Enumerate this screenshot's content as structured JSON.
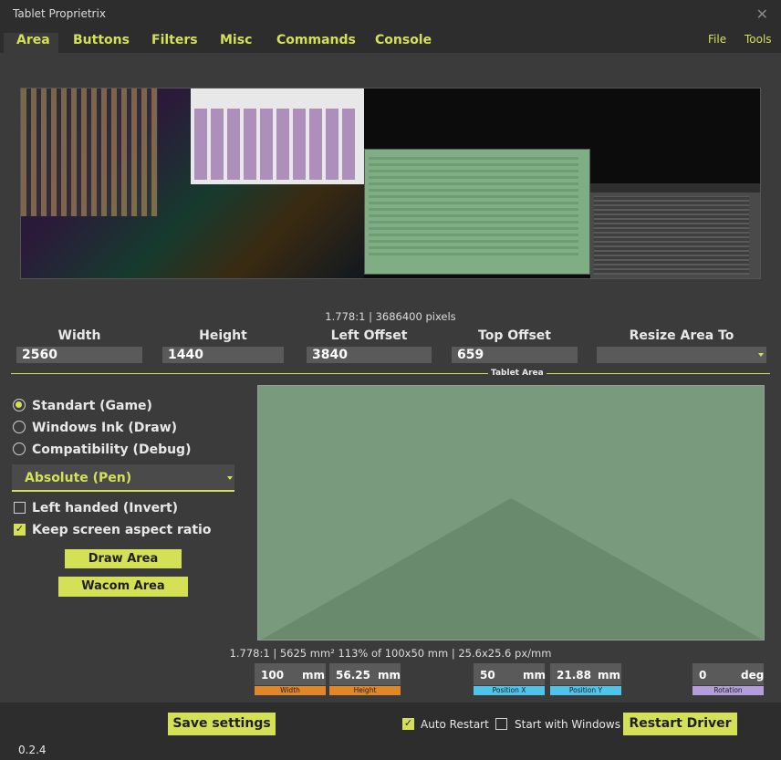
{
  "window": {
    "title": "Tablet Proprietrix",
    "close_icon": "close-icon"
  },
  "tabs": [
    {
      "label": "Area",
      "active": true
    },
    {
      "label": "Buttons"
    },
    {
      "label": "Filters"
    },
    {
      "label": "Misc"
    },
    {
      "label": "Commands"
    },
    {
      "label": "Console"
    }
  ],
  "menu": {
    "file": "File",
    "tools": "Tools"
  },
  "screen": {
    "caption": "1.778:1 | 3686400 pixels",
    "fields": {
      "width": {
        "label": "Width",
        "value": "2560"
      },
      "height": {
        "label": "Height",
        "value": "1440"
      },
      "left_offset": {
        "label": "Left Offset",
        "value": "3840"
      },
      "top_offset": {
        "label": "Top Offset",
        "value": "659"
      },
      "resize": {
        "label": "Resize Area To",
        "value": ""
      }
    }
  },
  "tablet_area": {
    "section_label": "Tablet Area",
    "modes": [
      {
        "label": "Standart (Game)",
        "selected": true
      },
      {
        "label": "Windows Ink (Draw)",
        "selected": false
      },
      {
        "label": "Compatibility (Debug)",
        "selected": false
      }
    ],
    "output_mode": "Absolute (Pen)",
    "left_handed": {
      "label": "Left handed (Invert)",
      "checked": false
    },
    "keep_aspect": {
      "label": "Keep screen aspect ratio",
      "checked": true
    },
    "draw_area_button": "Draw Area",
    "wacom_area_button": "Wacom Area",
    "caption": "1.778:1 | 5625 mm² 113% of 100x50 mm | 25.6x25.6 px/mm",
    "inputs": {
      "width": {
        "value": "100",
        "unit": "mm",
        "tag": "Width",
        "color": "#e0872a"
      },
      "height": {
        "value": "56.25",
        "unit": "mm",
        "tag": "Height",
        "color": "#e0872a"
      },
      "position_x": {
        "value": "50",
        "unit": "mm",
        "tag": "Position X",
        "color": "#4fc3e8"
      },
      "position_y": {
        "value": "21.88",
        "unit": "mm",
        "tag": "Position Y",
        "color": "#4fc3e8"
      },
      "rotation": {
        "value": "0",
        "unit": "deg",
        "tag": "Rotation",
        "color": "#b39ddb"
      }
    }
  },
  "footer": {
    "save_button": "Save settings",
    "auto_restart": {
      "label": "Auto Restart",
      "checked": true
    },
    "start_with_windows": {
      "label": "Start with Windows",
      "checked": false
    },
    "restart_button": "Restart Driver",
    "version": "0.2.4"
  }
}
